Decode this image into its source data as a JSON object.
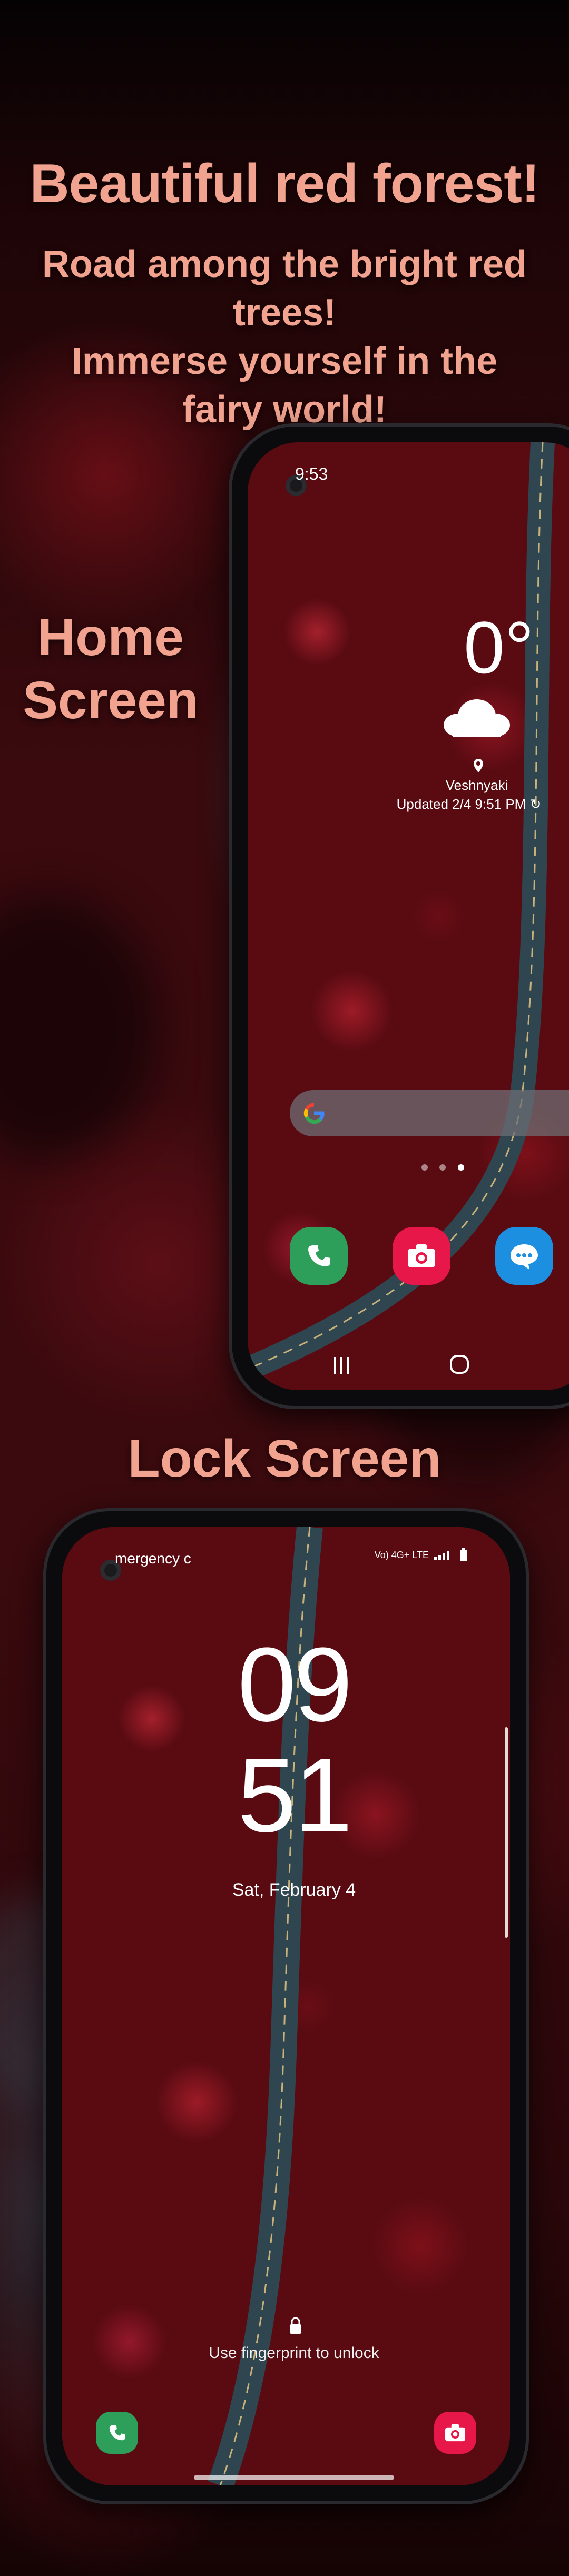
{
  "hero": {
    "title": "Beautiful red forest!",
    "subtitle_line1": "Road among the bright red trees!",
    "subtitle_line2": "Immerse yourself in the",
    "subtitle_line3": "fairy world!"
  },
  "labels": {
    "home_line1": "Home",
    "home_line2": "Screen",
    "lock": "Lock Screen"
  },
  "home_screen": {
    "status_time": "9:53",
    "weather": {
      "temperature": "0°",
      "location": "Veshnyaki",
      "updated": "Updated 2/4 9:51 PM",
      "icon": "cloud-icon"
    },
    "search_icon": "google-g-icon",
    "dock": [
      {
        "name": "phone",
        "icon": "phone-icon",
        "color": "#2e9e5b"
      },
      {
        "name": "camera",
        "icon": "camera-icon",
        "color": "#e8174a"
      },
      {
        "name": "messages",
        "icon": "chat-icon",
        "color": "#1d8fe0"
      }
    ],
    "nav_buttons": [
      "recents-icon",
      "home-icon"
    ]
  },
  "lock_screen": {
    "emergency": "mergency c",
    "status": "Vo) 4G+ LTE",
    "hour": "09",
    "minute": "51",
    "date": "Sat, February 4",
    "hint": "Use fingerprint to unlock"
  },
  "colors": {
    "accent_text": "#f2a38f",
    "forest": "#5a0b12",
    "road": "#2f4650"
  }
}
